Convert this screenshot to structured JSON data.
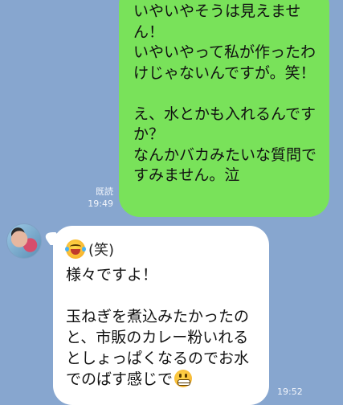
{
  "sent_message": {
    "text": "いやいやそうは見えません！\nいやいやって私が作ったわけじゃないんですが。笑！\n\nえ、水とかも入れるんですか？\nなんかバカみたいな質問ですみません。泣",
    "read_label": "既読",
    "time": "19:49"
  },
  "received_message": {
    "reaction_icon": "laughing-tears-emoji",
    "reaction_text": "(笑)",
    "text": "様々ですよ！\n\n玉ねぎを煮込みたかったのと、市販のカレー粉いれるとしょっぱくなるのでお水でのばす感じで",
    "trailing_icon": "grinning-teeth-emoji",
    "time": "19:52"
  }
}
